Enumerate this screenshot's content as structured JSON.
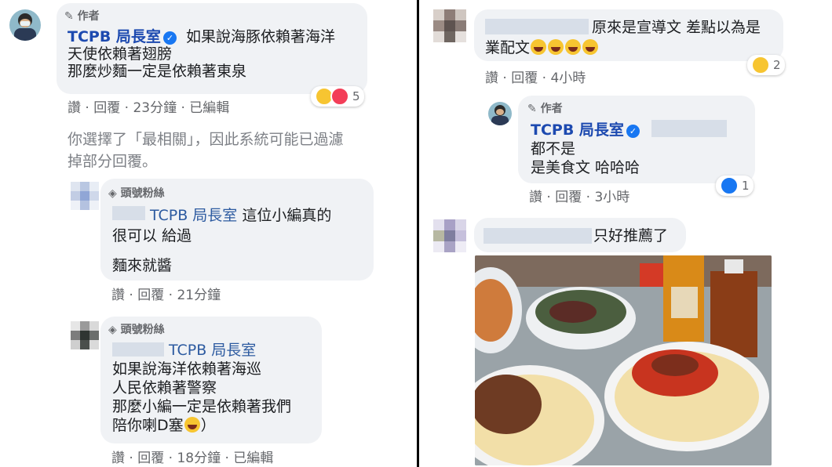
{
  "left": {
    "comment1": {
      "role": "作者",
      "author": "TCPB 局長室",
      "lines": [
        "如果說海豚依賴著海洋",
        "天使依賴著翅膀",
        "那麼炒麵一定是依賴著東泉"
      ],
      "reaction_count": "5",
      "actions": {
        "like": "讚",
        "reply": "回覆",
        "time": "23分鐘",
        "edited": "已編輯"
      }
    },
    "filter_notice": [
      "你選擇了「最相關」，因此系統可能已過濾",
      "掉部分回覆。"
    ],
    "reply1": {
      "role": "頭號粉絲",
      "tag": "TCPB 局長室",
      "lines": [
        "這位小編真的",
        "很可以 給過",
        "麵來就醬"
      ],
      "actions": {
        "like": "讚",
        "reply": "回覆",
        "time": "21分鐘"
      }
    },
    "reply2": {
      "role": "頭號粉絲",
      "tag": "TCPB 局長室",
      "lines": [
        "如果說海洋依賴著海巡",
        "人民依賴著警察",
        "那麼小編一定是依賴著我們",
        "陪你喇D塞",
        "）"
      ],
      "actions": {
        "like": "讚",
        "reply": "回覆",
        "time": "18分鐘",
        "edited": "已編輯"
      }
    }
  },
  "right": {
    "comment2": {
      "lines": [
        "原來是宣導文 差點以為是",
        "業配文"
      ],
      "reaction_count": "2",
      "actions": {
        "like": "讚",
        "reply": "回覆",
        "time": "4小時"
      }
    },
    "reply3": {
      "role": "作者",
      "author": "TCPB 局長室",
      "lines": [
        "都不是",
        "是美食文 哈哈哈"
      ],
      "reaction_count": "1",
      "actions": {
        "like": "讚",
        "reply": "回覆",
        "time": "3小時"
      }
    },
    "comment3": {
      "text": "只好推薦了",
      "photo_alt": "food photo"
    }
  },
  "separator": "·",
  "colors": {
    "bubble": "#f0f2f5",
    "name_blue": "#1d4ab0",
    "meta_gray": "#65676b",
    "verified_blue": "#1877f2"
  },
  "icons": {
    "pen": "pencil-icon",
    "diamond": "diamond-icon",
    "verified": "verified-badge-icon"
  }
}
